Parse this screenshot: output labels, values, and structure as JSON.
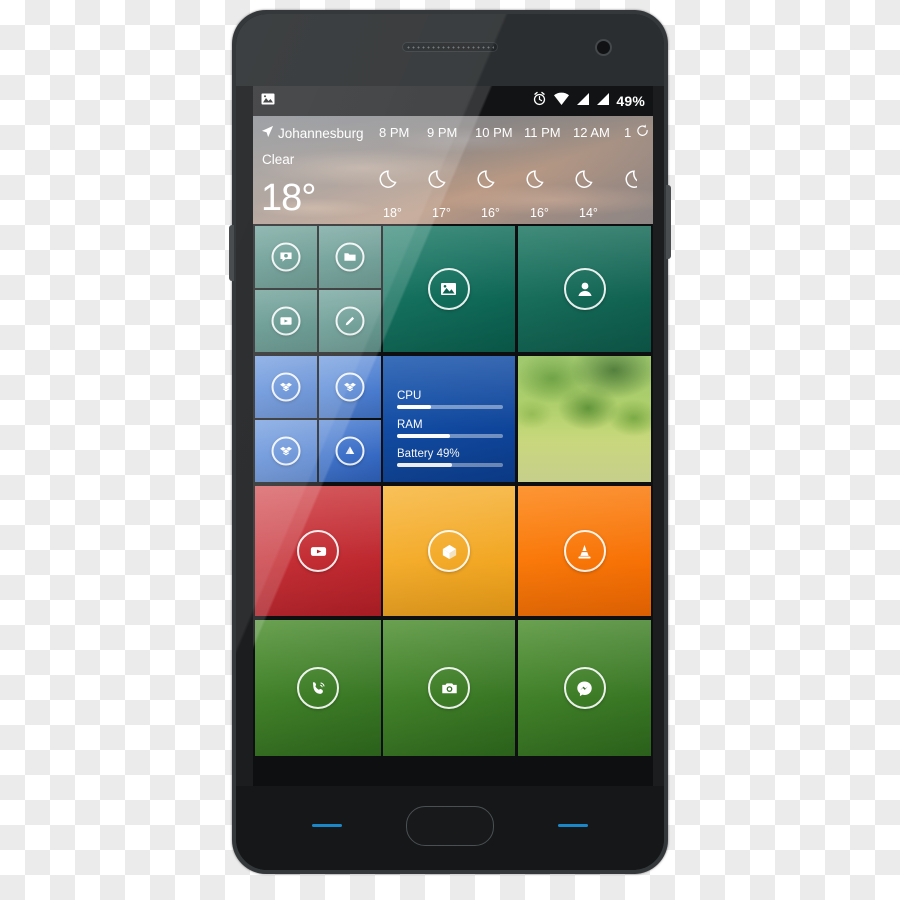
{
  "statusbar": {
    "notification_icon": "image-notification-icon",
    "alarm_icon": "alarm-clock-icon",
    "wifi_icon": "wifi-icon",
    "signal1_icon": "signal-bars-icon",
    "signal2_icon": "signal-bars-icon",
    "battery_percent": "49%"
  },
  "weather": {
    "location_icon": "location-arrow-icon",
    "location": "Johannesburg",
    "condition": "Clear",
    "current_temp": "18°",
    "refresh_icon": "refresh-icon",
    "hours": [
      {
        "label": "8 PM",
        "temp": "18°",
        "icon": "moon-icon"
      },
      {
        "label": "9 PM",
        "temp": "17°",
        "icon": "moon-icon"
      },
      {
        "label": "10 PM",
        "temp": "16°",
        "icon": "moon-icon"
      },
      {
        "label": "11 PM",
        "temp": "16°",
        "icon": "moon-icon"
      },
      {
        "label": "12 AM",
        "temp": "14°",
        "icon": "moon-icon"
      },
      {
        "label": "1",
        "temp": "",
        "icon": "moon-icon"
      }
    ]
  },
  "system_tile": {
    "rows": [
      {
        "label": "CPU",
        "percent": 32
      },
      {
        "label": "RAM",
        "percent": 50
      },
      {
        "label": "Battery 49%",
        "percent": 52
      }
    ]
  },
  "tiles": {
    "messaging": {
      "name": "messaging-tile",
      "icon": "chat-bubble-icon",
      "color": "#4e8a81"
    },
    "files": {
      "name": "files-tile",
      "icon": "folder-icon",
      "color": "#4e8a81"
    },
    "video": {
      "name": "video-tile",
      "icon": "video-player-icon",
      "color": "#3e8277"
    },
    "notes": {
      "name": "notes-tile",
      "icon": "pencil-icon",
      "color": "#4e8a81"
    },
    "gallery": {
      "name": "gallery-tile",
      "icon": "picture-icon",
      "color": "#0c6a58"
    },
    "contacts": {
      "name": "contacts-tile",
      "icon": "person-icon",
      "color": "#176b5b"
    },
    "dropbox1": {
      "name": "dropbox-tile",
      "icon": "dropbox-icon",
      "color": "#4a7fd4"
    },
    "dropbox2": {
      "name": "dropbox-tile",
      "icon": "dropbox-icon",
      "color": "#4a7fd4"
    },
    "dropbox3": {
      "name": "dropbox-tile",
      "icon": "dropbox-icon",
      "color": "#4a7fd4"
    },
    "drive": {
      "name": "drive-tile",
      "icon": "drive-triangle-icon",
      "color": "#3f74cf"
    },
    "system": {
      "name": "system-monitor-tile",
      "color": "#12479e"
    },
    "nature": {
      "name": "nature-photo-tile"
    },
    "youtube": {
      "name": "youtube-tile",
      "icon": "youtube-icon",
      "color": "#c62a31"
    },
    "boxapp": {
      "name": "box-tile",
      "icon": "cube-box-icon",
      "color": "#f5aa26"
    },
    "vlc": {
      "name": "vlc-tile",
      "icon": "traffic-cone-icon",
      "color": "#f97307"
    },
    "viber": {
      "name": "viber-tile",
      "icon": "phone-call-icon",
      "color": "#3a7a24"
    },
    "camera": {
      "name": "camera-tile",
      "icon": "camera-icon",
      "color": "#3a7a24"
    },
    "messenger": {
      "name": "messenger-tile",
      "icon": "messenger-bolt-icon",
      "color": "#3a7a24"
    }
  },
  "navbar": {
    "back_key": "back-capacitive-key",
    "home_button": "home-button",
    "recents_key": "recents-capacitive-key",
    "accent": "#1a87c9"
  },
  "hardware": {
    "speaker": "earpiece-speaker",
    "front_camera": "front-camera",
    "volume_button": "volume-button",
    "power_button": "power-button"
  }
}
